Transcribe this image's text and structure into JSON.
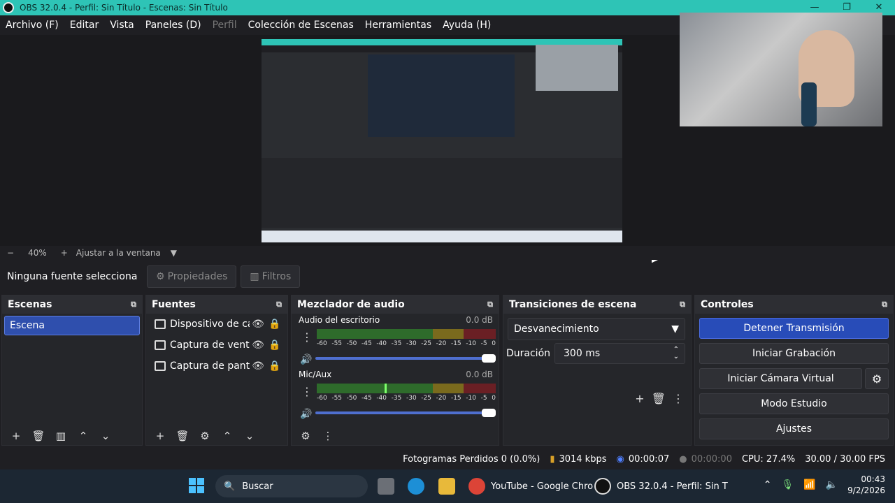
{
  "window": {
    "title": "OBS 32.0.4 - Perfil: Sin Título - Escenas: Sin Título"
  },
  "menu": [
    "Archivo (F)",
    "Editar",
    "Vista",
    "Paneles (D)",
    "Perfil",
    "Colección de Escenas",
    "Herramientas",
    "Ayuda (H)"
  ],
  "zoom": {
    "minus": "−",
    "value": "40%",
    "plus": "+",
    "fit": "Ajustar a la ventana"
  },
  "props": {
    "no_selection": "Ninguna fuente selecciona",
    "properties": "Propiedades",
    "filters": "Filtros"
  },
  "scenes": {
    "title": "Escenas",
    "items": [
      "Escena"
    ]
  },
  "sources": {
    "title": "Fuentes",
    "items": [
      "Dispositivo de cap",
      "Captura de ventan",
      "Captura de pantall"
    ]
  },
  "mixer": {
    "title": "Mezclador de audio",
    "scale": [
      "-60",
      "-55",
      "-50",
      "-45",
      "-40",
      "-35",
      "-30",
      "-25",
      "-20",
      "-15",
      "-10",
      "-5",
      "0"
    ],
    "channels": [
      {
        "name": "Audio del escritorio",
        "db": "0.0 dB",
        "level": 0.0,
        "volume": 1.0
      },
      {
        "name": "Mic/Aux",
        "db": "0.0 dB",
        "level": 0.38,
        "volume": 1.0
      }
    ]
  },
  "transitions": {
    "title": "Transiciones de escena",
    "selected": "Desvanecimiento",
    "duration_label": "Duración",
    "duration_value": "300 ms"
  },
  "controls": {
    "title": "Controles",
    "stop_stream": "Detener Transmisión",
    "start_recording": "Iniciar Grabación",
    "virtual_cam": "Iniciar Cámara Virtual",
    "studio_mode": "Modo Estudio",
    "settings": "Ajustes"
  },
  "status": {
    "dropped": "Fotogramas Perdidos 0 (0.0%)",
    "bitrate": "3014 kbps",
    "stream_time": "00:00:07",
    "rec_time": "00:00:00",
    "cpu": "CPU: 27.4%",
    "fps": "30.00 / 30.00 FPS"
  },
  "taskbar": {
    "search": "Buscar",
    "chrome": "YouTube - Google Chro",
    "obs": "OBS 32.0.4 - Perfil: Sin T",
    "time": "00:43",
    "date": "9/2/2026"
  },
  "colors": {
    "accent": "#2ec4b6",
    "primary_button": "#284cb8"
  }
}
